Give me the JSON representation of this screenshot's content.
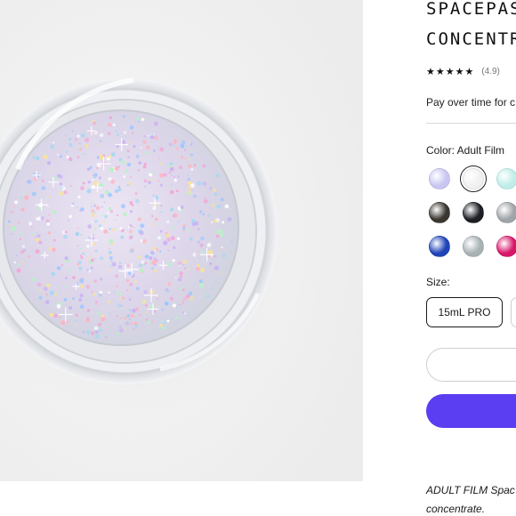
{
  "product": {
    "title_line1": "SPACEPAS",
    "title_line2": "CONCENTR",
    "stars": "★★★★★",
    "rating": "(4.9)",
    "pay_over_time": "Pay over time for c",
    "color_label": "Color: Adult Film",
    "size_label": "Size:",
    "size_option": "15mL PRO",
    "description_line1": "ADULT FILM Spac",
    "description_line2": "concentrate."
  },
  "swatches": [
    {
      "name": "lavender-holo",
      "color": "#c9c7f2",
      "selected": false
    },
    {
      "name": "adult-film",
      "color": "#f1f1f3",
      "selected": true
    },
    {
      "name": "aqua-shimmer",
      "color": "#bfeeea",
      "selected": false
    },
    {
      "name": "black-gold",
      "color": "#3a3630",
      "selected": false
    },
    {
      "name": "black-multi",
      "color": "#1c1f24",
      "selected": false
    },
    {
      "name": "silver",
      "color": "#9fa4a8",
      "selected": false
    },
    {
      "name": "royal-blue",
      "color": "#1f44b8",
      "selected": false
    },
    {
      "name": "silver-holo",
      "color": "#a8b2b5",
      "selected": false
    },
    {
      "name": "magenta",
      "color": "#d8176a",
      "selected": false
    }
  ],
  "colors": {
    "accent": "#5b3df2",
    "border": "#1a1a1a"
  }
}
